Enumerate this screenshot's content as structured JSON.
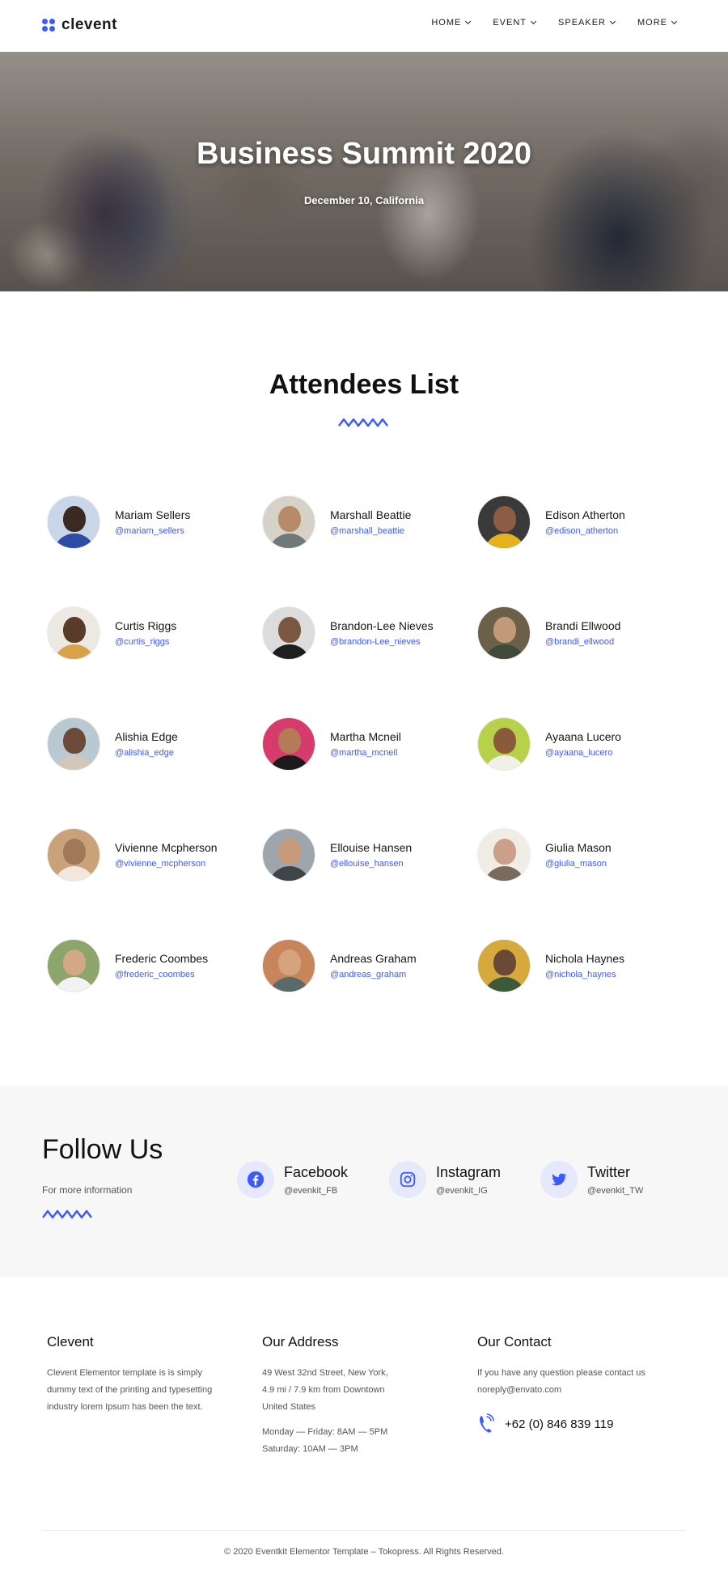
{
  "brand": {
    "name": "clevent",
    "accent": "#3d5afe"
  },
  "nav": [
    {
      "label": "HOME"
    },
    {
      "label": "EVENT"
    },
    {
      "label": "SPEAKER"
    },
    {
      "label": "MORE"
    }
  ],
  "hero": {
    "title": "Business Summit 2020",
    "subtitle": "December 10, California"
  },
  "attendees": {
    "title": "Attendees List",
    "items": [
      {
        "name": "Mariam Sellers",
        "handle": "@mariam_sellers"
      },
      {
        "name": "Marshall Beattie",
        "handle": "@marshall_beattie"
      },
      {
        "name": "Edison Atherton",
        "handle": "@edison_atherton"
      },
      {
        "name": "Curtis Riggs",
        "handle": "@curtis_riggs"
      },
      {
        "name": "Brandon-Lee Nieves",
        "handle": "@brandon-Lee_nieves"
      },
      {
        "name": "Brandi Ellwood",
        "handle": "@brandi_ellwood"
      },
      {
        "name": "Alishia Edge",
        "handle": "@alishia_edge"
      },
      {
        "name": "Martha Mcneil",
        "handle": "@martha_mcneil"
      },
      {
        "name": "Ayaana Lucero",
        "handle": "@ayaana_lucero"
      },
      {
        "name": "Vivienne Mcpherson",
        "handle": "@vivienne_mcpherson"
      },
      {
        "name": "Ellouise Hansen",
        "handle": "@ellouise_hansen"
      },
      {
        "name": "Giulia Mason",
        "handle": "@giulia_mason"
      },
      {
        "name": "Frederic Coombes",
        "handle": "@frederic_coombes"
      },
      {
        "name": "Andreas Graham",
        "handle": "@andreas_graham"
      },
      {
        "name": "Nichola Haynes",
        "handle": "@nichola_haynes"
      }
    ]
  },
  "follow": {
    "title": "Follow Us",
    "subtitle": "For more information",
    "networks": [
      {
        "name": "Facebook",
        "handle": "@evenkit_FB",
        "icon": "facebook-icon"
      },
      {
        "name": "Instagram",
        "handle": "@evenkit_IG",
        "icon": "instagram-icon"
      },
      {
        "name": "Twitter",
        "handle": "@evenkit_TW",
        "icon": "twitter-icon"
      }
    ]
  },
  "footer": {
    "about": {
      "title": "Clevent",
      "text": "Clevent Elementor template is is simply dummy text of the printing and typesetting industry lorem Ipsum has been the text."
    },
    "address": {
      "title": "Our Address",
      "line1": "49 West 32nd Street, New York, 4.9 mi / 7.9 km from Downtown United States",
      "hours1": "Monday — Friday: 8AM — 5PM",
      "hours2": "Saturday: 10AM — 3PM"
    },
    "contact": {
      "title": "Our Contact",
      "text1": "If you have any question please contact us",
      "email": "noreply@envato.com",
      "phone": "+62 (0) 846 839 119"
    },
    "copyright": "© 2020 Eventkit Elementor Template – Tokopress. All Rights Reserved."
  }
}
